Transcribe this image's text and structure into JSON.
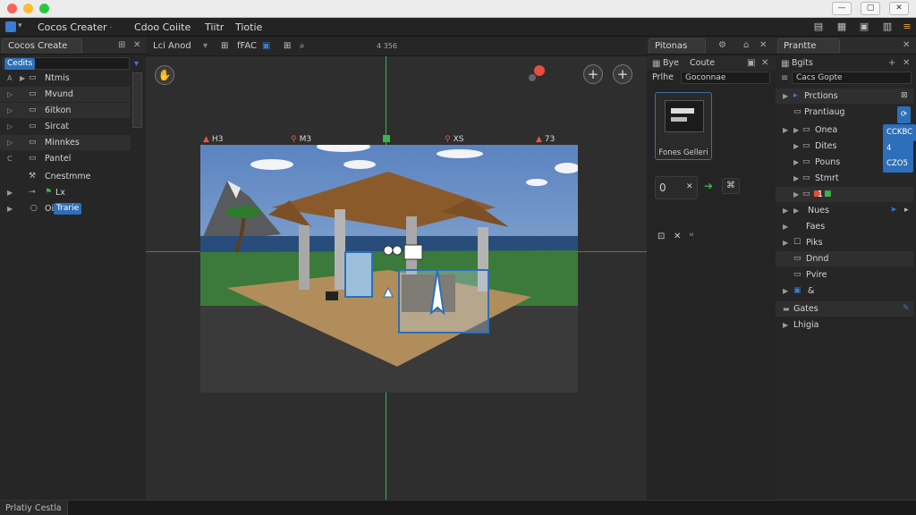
{
  "menubar": {
    "app_name": "Cocos Creater",
    "items": [
      "Cdoo Coiite",
      "Tiitr",
      "Tiotie"
    ]
  },
  "hierarchy": {
    "tab": "Cocos Create",
    "search_chip": "Cedits",
    "rows": [
      {
        "label": "Ntmis"
      },
      {
        "label": "Mvund"
      },
      {
        "label": "6itkon"
      },
      {
        "label": "Sircat"
      },
      {
        "label": "Minnkes"
      },
      {
        "label": "Pantel"
      },
      {
        "label": "Cnestmme"
      },
      {
        "label": "Lx"
      },
      {
        "label": "Oi",
        "chip": "Trarie"
      }
    ]
  },
  "scene": {
    "tab": "Lci Anod",
    "toolbar_text": "fFAC",
    "coord": "4 356",
    "markers": [
      "H3",
      "M3",
      "XS",
      "73"
    ]
  },
  "assets": {
    "tabs": [
      "Pitonas",
      "Bye",
      "Coute"
    ],
    "search_label": "Prlhe",
    "search_value": "Goconnae",
    "thumb_label": "Fones Gelleri",
    "field_value": "0"
  },
  "inspector": {
    "tab": "Prantte",
    "subtab": "Bgits",
    "search_value": "Cacs  Gopte",
    "rows": [
      {
        "label": "Prctions",
        "arrow": true
      },
      {
        "label": "Prantiaug",
        "arrow": false
      },
      {
        "label": "Onea",
        "arrow": true,
        "badge": "CCKBC"
      },
      {
        "label": "Dites",
        "arrow": true,
        "badge": "4 CZO5"
      },
      {
        "label": "Pouns",
        "arrow": true
      },
      {
        "label": "Stmrt",
        "arrow": true
      },
      {
        "label": "1",
        "arrow": true
      },
      {
        "label": "Nues",
        "arrow": true
      },
      {
        "label": "Faes",
        "arrow": true
      },
      {
        "label": "Piks",
        "arrow": true
      },
      {
        "label": "Dnnd",
        "arrow": false
      },
      {
        "label": "Pvire",
        "arrow": false
      },
      {
        "label": "&",
        "arrow": true
      }
    ],
    "section": "Gates",
    "section_row": "Lhigia"
  },
  "statusbar": {
    "tab": "Prlatiy  Cestla"
  },
  "colors": {
    "accent": "#2d6fb8",
    "green_axis": "#39b54a",
    "red_dot": "#e84c3d"
  }
}
